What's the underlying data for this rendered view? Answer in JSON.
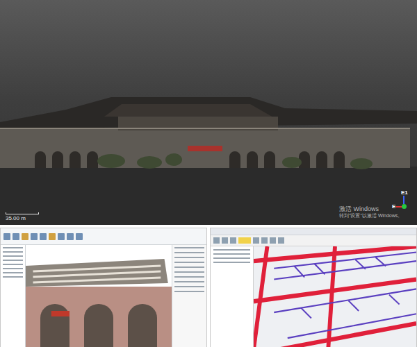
{
  "viewer": {
    "scale_label": "35.00 m",
    "compass": {
      "up": "E1",
      "left": "E"
    },
    "watermark": {
      "title": "激活 Windows",
      "hint": "转到\"设置\"以激活 Windows。"
    }
  }
}
